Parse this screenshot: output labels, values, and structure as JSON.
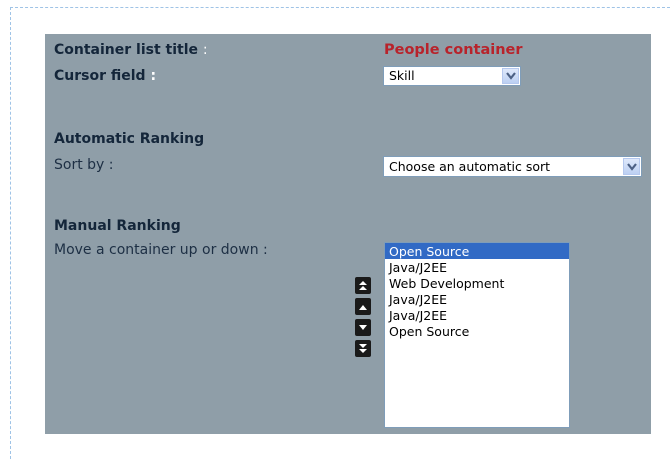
{
  "container_list": {
    "label": "Container list title",
    "colon": ":",
    "value": "People container"
  },
  "cursor_field": {
    "label": "Cursor field",
    "colon": ":",
    "selected": "Skill",
    "icon": "chevron-down-icon"
  },
  "automatic_ranking": {
    "heading": "Automatic Ranking",
    "sort_label": "Sort by :",
    "sort_selected": "Choose an automatic sort"
  },
  "manual_ranking": {
    "heading": "Manual Ranking",
    "move_label": "Move a container up or down :",
    "items": [
      {
        "label": "Open Source",
        "selected": true
      },
      {
        "label": "Java/J2EE",
        "selected": false
      },
      {
        "label": "Web Development",
        "selected": false
      },
      {
        "label": "Java/J2EE",
        "selected": false
      },
      {
        "label": "Java/J2EE",
        "selected": false
      },
      {
        "label": "Open Source",
        "selected": false
      }
    ],
    "buttons": [
      "move-top-icon",
      "move-up-icon",
      "move-down-icon",
      "move-bottom-icon"
    ]
  },
  "colors": {
    "panel": "#8f9ea8",
    "accent_red": "#b8232b",
    "selection": "#316ac5"
  }
}
